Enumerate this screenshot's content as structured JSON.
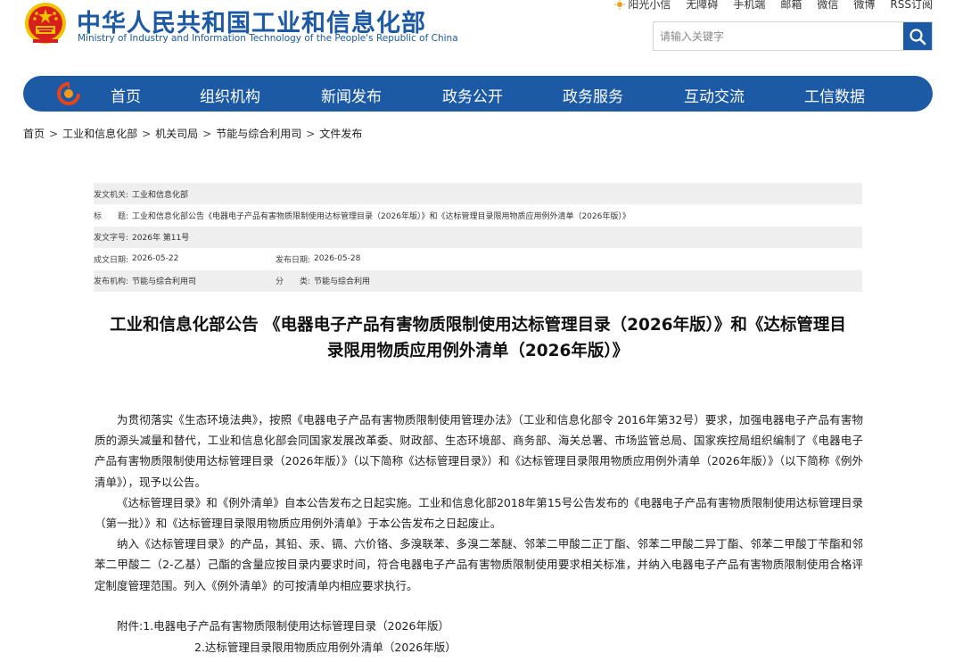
{
  "header": {
    "site_title_cn": "中华人民共和国工业和信息化部",
    "site_title_en": "Ministry of Industry and Information Technology of the People's Republic of China",
    "top_links": [
      "阳光小信",
      "无障碍",
      "手机端",
      "邮箱",
      "微信",
      "微博",
      "RSS订阅"
    ],
    "search_placeholder": "请输入关键字"
  },
  "nav": {
    "items": [
      "首页",
      "组织机构",
      "新闻发布",
      "政务公开",
      "政务服务",
      "互动交流",
      "工信数据"
    ]
  },
  "breadcrumb": [
    "首页",
    "工业和信息化部",
    "机关司局",
    "节能与综合利用司",
    "文件发布"
  ],
  "meta": {
    "issuer_label": "发文机关:",
    "issuer": "工业和信息化部",
    "title_label": "标　　题:",
    "title": "工业和信息化部公告《电器电子产品有害物质限制使用达标管理目录（2026年版）》和《达标管理目录限用物质应用例外清单（2026年版）》",
    "doc_no_label": "发文字号:",
    "doc_no": "2026年 第11号",
    "created_label": "成文日期:",
    "created": "2026-05-22",
    "published_label": "发布日期:",
    "published": "2026-05-28",
    "org_label": "发布机构:",
    "org": "节能与综合利用司",
    "category_label": "分　　类:",
    "category": "节能与综合利用"
  },
  "document": {
    "title_line1": "工业和信息化部公告 《电器电子产品有害物质限制使用达标管理目录（2026年版）》和《达标管理目",
    "title_line2": "录限用物质应用例外清单（2026年版）》",
    "paragraphs": [
      "为贯彻落实《生态环境法典》，按照《电器电子产品有害物质限制使用管理办法》（工业和信息化部令 2016年第32号）要求，加强电器电子产品有害物质的源头减量和替代，工业和信息化部会同国家发展改革委、财政部、生态环境部、商务部、海关总署、市场监管总局、国家疾控局组织编制了《电器电子产品有害物质限制使用达标管理目录（2026年版）》（以下简称《达标管理目录》）和《达标管理目录限用物质应用例外清单（2026年版）》（以下简称《例外清单》），现予以公告。",
      "《达标管理目录》和《例外清单》自本公告发布之日起实施。工业和信息化部2018年第15号公告发布的《电器电子产品有害物质限制使用达标管理目录（第一批）》和《达标管理目录限用物质应用例外清单》于本公告发布之日起废止。",
      "纳入《达标管理目录》的产品，其铅、汞、镉、六价铬、多溴联苯、多溴二苯醚、邻苯二甲酸二正丁酯、邻苯二甲酸二异丁酯、邻苯二甲酸丁苄酯和邻苯二甲酸二（2-乙基）己酯的含量应按目录内要求时间，符合电器电子产品有害物质限制使用要求相关标准，并纳入电器电子产品有害物质限制使用合格评定制度管理范围。列入《例外清单》的可按清单内相应要求执行。"
    ],
    "attachments_line1": "附件:1.电器电子产品有害物质限制使用达标管理目录（2026年版）",
    "attachments_line2": "2.达标管理目录限用物质应用例外清单（2026年版）"
  },
  "colors": {
    "brand_blue": "#1c5aa6",
    "emblem_red": "#d7201d",
    "emblem_gold": "#f2c200",
    "meta_row_bg": "#efefef"
  },
  "icons": [
    "national-emblem-icon",
    "sun-icon",
    "search-icon",
    "ministry-logo-icon"
  ]
}
